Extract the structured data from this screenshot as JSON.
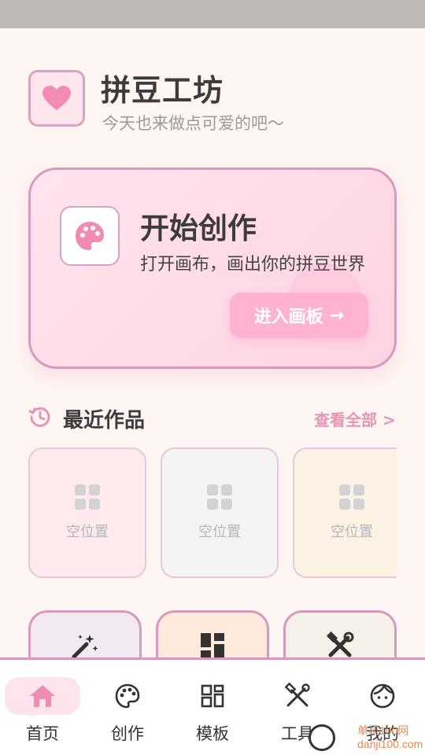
{
  "header": {
    "title": "拼豆工坊",
    "subtitle": "今天也来做点可爱的吧～"
  },
  "hero": {
    "title": "开始创作",
    "subtitle": "打开画布，画出你的拼豆世界",
    "button_label": "进入画板",
    "button_arrow": "→"
  },
  "recent": {
    "title": "最近作品",
    "view_all": "查看全部 >",
    "slots": [
      {
        "label": "空位置",
        "bg": "#ffeaee"
      },
      {
        "label": "空位置",
        "bg": "#f4f4f4"
      },
      {
        "label": "空位置",
        "bg": "#fdf2e4"
      }
    ]
  },
  "tools": [
    {
      "icon": "magic-wand-icon",
      "bg": "#f3e9f1"
    },
    {
      "icon": "dashboard-icon",
      "bg": "#ffeadd"
    },
    {
      "icon": "hammer-wrench-icon",
      "bg": "#f6f1e9"
    }
  ],
  "nav": {
    "items": [
      {
        "label": "首页",
        "icon": "home-icon",
        "active": true
      },
      {
        "label": "创作",
        "icon": "palette-icon"
      },
      {
        "label": "模板",
        "icon": "grid-icon"
      },
      {
        "label": "工具",
        "icon": "tools-icon"
      },
      {
        "label": "我的",
        "icon": "face-icon"
      }
    ]
  },
  "watermark": {
    "line1": "单机100网",
    "line2": "danji100.com"
  },
  "colors": {
    "accent": "#e596b6",
    "border": "#d79abb",
    "background": "#fff6f3",
    "status_bar": "#bdb8b4"
  }
}
